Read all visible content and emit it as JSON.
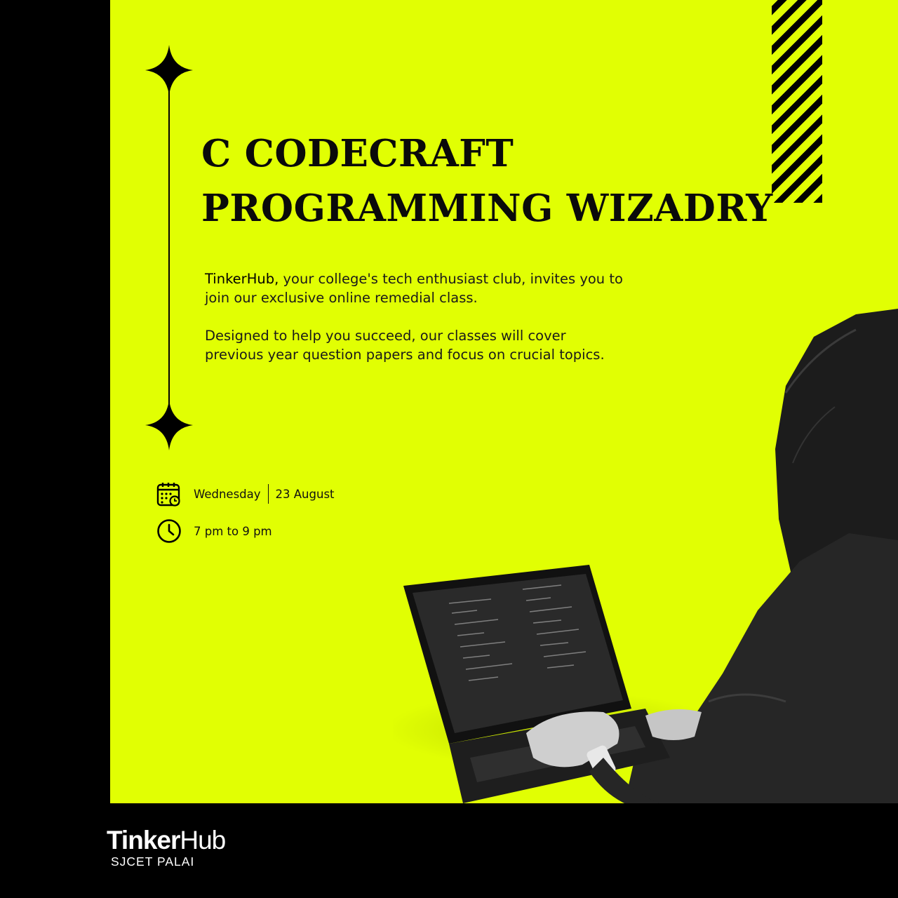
{
  "colors": {
    "accent": "#e1ff03",
    "background": "#000000",
    "text": "#0a0a0a"
  },
  "title": {
    "line1": "C CODECRAFT",
    "line2": "PROGRAMMING WIZADRY"
  },
  "intro": {
    "brand": "TinkerHub,",
    "para1_rest": " your college's tech enthusiast club, invites you to join our exclusive online remedial class.",
    "para2": "Designed to help you succeed, our classes will cover previous year question papers and focus on crucial topics."
  },
  "event": {
    "day": "Wednesday",
    "date": "23 August",
    "time": "7 pm to 9 pm",
    "date_icon": "calendar-clock-icon",
    "time_icon": "clock-icon"
  },
  "photo": {
    "subject": "person-using-laptop"
  },
  "footer": {
    "brand_bold": "Tinker",
    "brand_light": "Hub",
    "subtitle": "SJCET PALAI"
  }
}
